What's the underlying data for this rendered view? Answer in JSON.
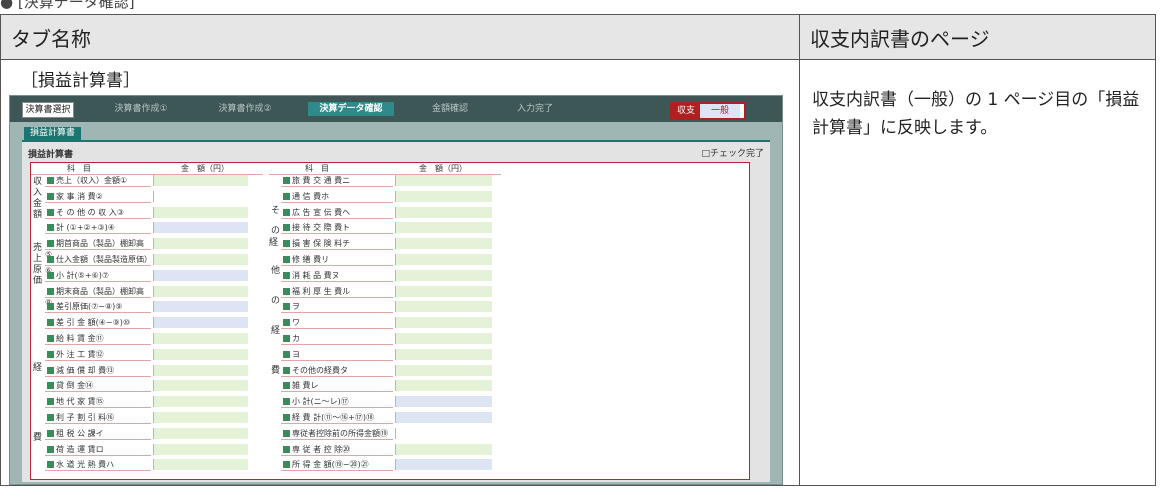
{
  "top_note": "● [決算データ確認]",
  "table": {
    "col1_header": "タブ名称",
    "col2_header": "収支内訳書のページ",
    "tab_label": "［損益計算書］",
    "description": "収支内訳書（一般）の 1 ページ目の「損益計算書」に反映します。"
  },
  "shot": {
    "select_button": "決算書選択",
    "steps": [
      "決算書作成①",
      "決算書作成②",
      "決算データ確認",
      "金額確認",
      "入力完了"
    ],
    "active_step": 2,
    "badge_a": "収支",
    "badge_b": "一般",
    "tab": "損益計算書",
    "panel_title": "損益計算書",
    "check_label": "□チェック完了",
    "header_left": [
      "科　目",
      "金　額（円）"
    ],
    "header_right": [
      "科　目",
      "金　額（円）"
    ],
    "left_rows": [
      "売上（収入）金額①",
      "家 事 消 費②",
      "そ の 他 の 収 入③",
      "計 (①+②+③)④",
      "期首商品（製品）棚卸高⑤",
      "仕入金額（製品製造原価）⑥",
      "小 計(⑤+⑥)⑦",
      "期末商品（製品）棚卸高⑧",
      "差引原価(⑦−⑧)⑨",
      "差 引 金 額(④−⑨)⑩",
      "給 料 賃 金⑪",
      "外 注 工 賃⑫",
      "減 価 償 却 費⑬",
      "貸 倒 金⑭",
      "地 代 家 賃⑮",
      "利 子 割 引 料⑯",
      "租 税 公 課イ",
      "荷 造 運 賃ロ",
      "水 道 光 熱 費ハ"
    ],
    "right_rows": [
      "旅 費 交 通 費ニ",
      "通 信 費ホ",
      "広 告 宣 伝 費ヘ",
      "接 待 交 際 費ト",
      "損 害 保 険 料チ",
      "修 繕 費リ",
      "消 耗 品 費ヌ",
      "福 利 厚 生 費ル",
      "ヲ",
      "ワ",
      "カ",
      "ヨ",
      "その他の経費タ",
      "雑 費レ",
      "小 計(ニ〜レ)⑰",
      "経 費 計(⑪〜⑯+⑰)⑱",
      "専従者控除前の所得金額⑲",
      "専 従 者 控 除⑳",
      "所 得 金 額(⑲−⑳)㉑"
    ],
    "left_groups": [
      "収入金額",
      "売上原価",
      "経",
      "費"
    ],
    "right_groups": [
      "経",
      "そ",
      "の",
      "他",
      "の",
      "経",
      "費"
    ]
  }
}
